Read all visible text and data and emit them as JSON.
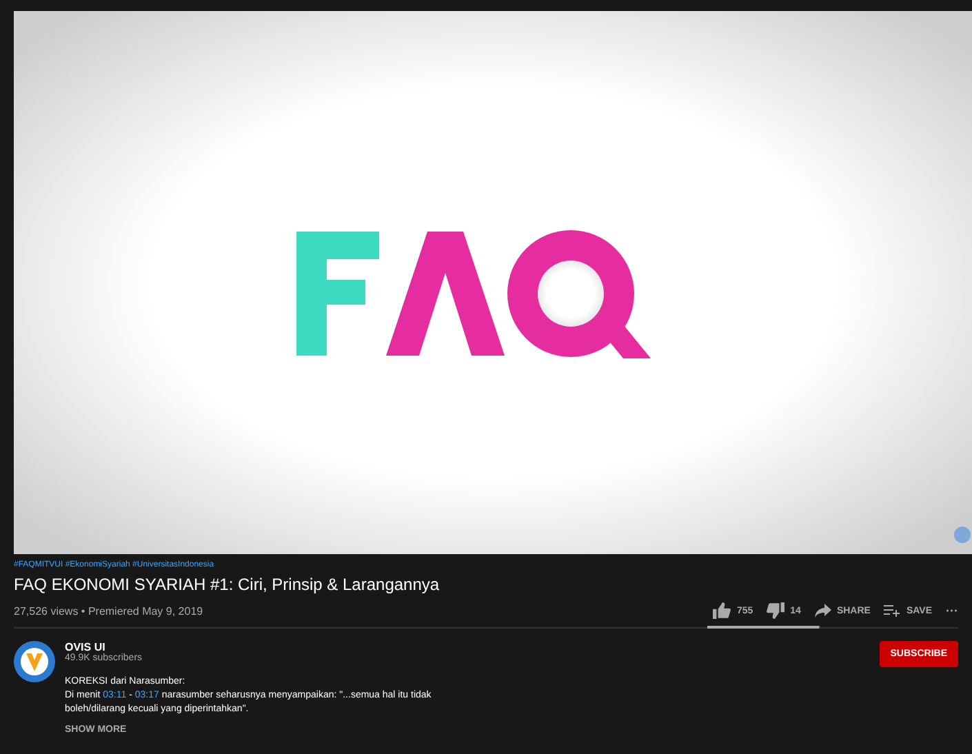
{
  "hashtags": "#FAQMITVUI #EkonomiSyariah #UniversitasIndonesia",
  "title": "FAQ EKONOMI SYARIAH #1: Ciri, Prinsip & Larangannya",
  "meta": "27,526 views • Premiered May 9, 2019",
  "actions": [
    {
      "kind": "like",
      "label": "755"
    },
    {
      "kind": "dislike",
      "label": "14"
    },
    {
      "kind": "share",
      "label": "SHARE"
    },
    {
      "kind": "save",
      "label": "SAVE"
    },
    {
      "kind": "more",
      "label": "···"
    }
  ],
  "sentiment": {
    "level": 0.98
  },
  "channel": {
    "name": "OVIS UI",
    "subscribers": "49.9K subscribers",
    "subscribe": "SUBSCRIBE"
  },
  "description": [
    [
      {
        "text": "KOREKSI dari Narasumber:",
        "kind": "text"
      }
    ],
    [
      {
        "text": "Di menit ",
        "kind": "text"
      },
      {
        "text": "03:11",
        "kind": "link"
      },
      {
        "text": " - ",
        "kind": "text"
      },
      {
        "text": "03:17",
        "kind": "link"
      },
      {
        "text": " narasumber seharusnya menyampaikan: \"...semua hal itu tidak",
        "kind": "text"
      }
    ],
    [
      {
        "text": "boleh/dilarang kecuali yang diperintahkan\".",
        "kind": "text"
      }
    ]
  ],
  "show_more": "SHOW MORE"
}
